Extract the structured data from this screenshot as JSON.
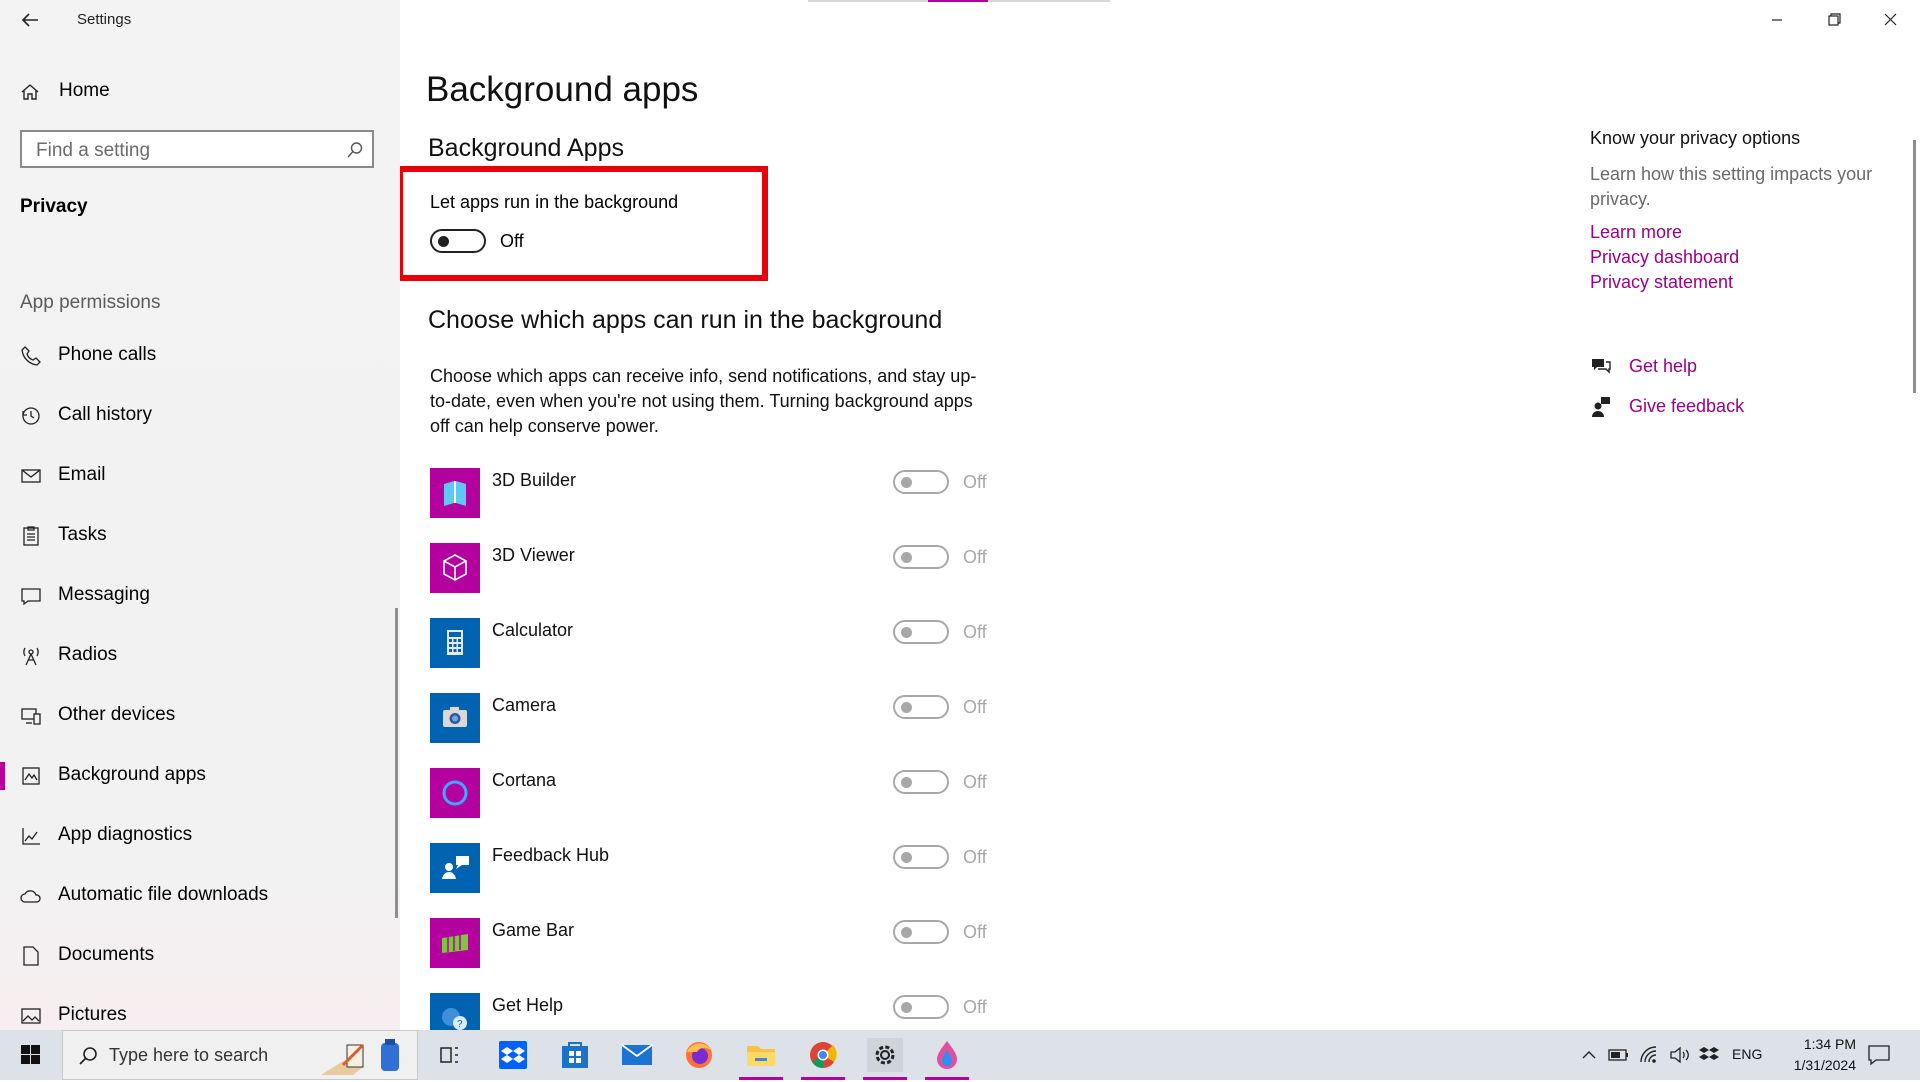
{
  "window": {
    "title": "Settings",
    "minimize_icon": "minimize-icon",
    "maximize_icon": "restore-icon",
    "close_icon": "close-icon"
  },
  "sidebar": {
    "home_label": "Home",
    "search_placeholder": "Find a setting",
    "section": "Privacy",
    "group_label": "App permissions",
    "items": [
      {
        "label": "Phone calls",
        "icon": "phone-icon"
      },
      {
        "label": "Call history",
        "icon": "history-icon"
      },
      {
        "label": "Email",
        "icon": "mail-icon"
      },
      {
        "label": "Tasks",
        "icon": "clipboard-icon"
      },
      {
        "label": "Messaging",
        "icon": "chat-icon"
      },
      {
        "label": "Radios",
        "icon": "antenna-icon"
      },
      {
        "label": "Other devices",
        "icon": "devices-icon"
      },
      {
        "label": "Background apps",
        "icon": "background-apps-icon",
        "selected": true
      },
      {
        "label": "App diagnostics",
        "icon": "chart-icon"
      },
      {
        "label": "Automatic file downloads",
        "icon": "cloud-icon"
      },
      {
        "label": "Documents",
        "icon": "document-icon"
      },
      {
        "label": "Pictures",
        "icon": "picture-icon"
      }
    ]
  },
  "main": {
    "page_title": "Background apps",
    "subtitle": "Background Apps",
    "master_toggle": {
      "label": "Let apps run in the background",
      "state": "Off",
      "on": false
    },
    "choose_title": "Choose which apps can run in the background",
    "choose_description": "Choose which apps can receive info, send notifications, and stay up-to-date, even when you're not using them. Turning background apps off can help conserve power.",
    "apps": [
      {
        "name": "3D Builder",
        "state": "Off",
        "tile_color": "#b4009e",
        "icon": "3d-builder-icon"
      },
      {
        "name": "3D Viewer",
        "state": "Off",
        "tile_color": "#b4009e",
        "icon": "3d-viewer-icon"
      },
      {
        "name": "Calculator",
        "state": "Off",
        "tile_color": "#0063b1",
        "icon": "calculator-icon"
      },
      {
        "name": "Camera",
        "state": "Off",
        "tile_color": "#0063b1",
        "icon": "camera-icon"
      },
      {
        "name": "Cortana",
        "state": "Off",
        "tile_color": "#b4009e",
        "icon": "cortana-icon"
      },
      {
        "name": "Feedback Hub",
        "state": "Off",
        "tile_color": "#0063b1",
        "icon": "feedback-hub-icon"
      },
      {
        "name": "Game Bar",
        "state": "Off",
        "tile_color": "#b4009e",
        "icon": "game-bar-icon"
      },
      {
        "name": "Get Help",
        "state": "Off",
        "tile_color": "#0063b1",
        "icon": "get-help-icon"
      }
    ]
  },
  "right_panel": {
    "title": "Know your privacy options",
    "description": "Learn how this setting impacts your privacy.",
    "links": [
      "Learn more",
      "Privacy dashboard",
      "Privacy statement"
    ],
    "get_help": "Get help",
    "give_feedback": "Give feedback"
  },
  "taskbar": {
    "search_placeholder": "Type here to search",
    "language": "ENG",
    "time": "1:34 PM",
    "date": "1/31/2024",
    "pinned": [
      "task-view-icon",
      "dropbox-icon",
      "store-icon",
      "mail-icon",
      "firefox-icon",
      "file-explorer-icon",
      "chrome-icon",
      "settings-icon",
      "paint-icon"
    ]
  },
  "colors": {
    "accent": "#b4009e",
    "link": "#9a0089",
    "highlight_box": "#e8000b",
    "tile_blue": "#0063b1"
  }
}
